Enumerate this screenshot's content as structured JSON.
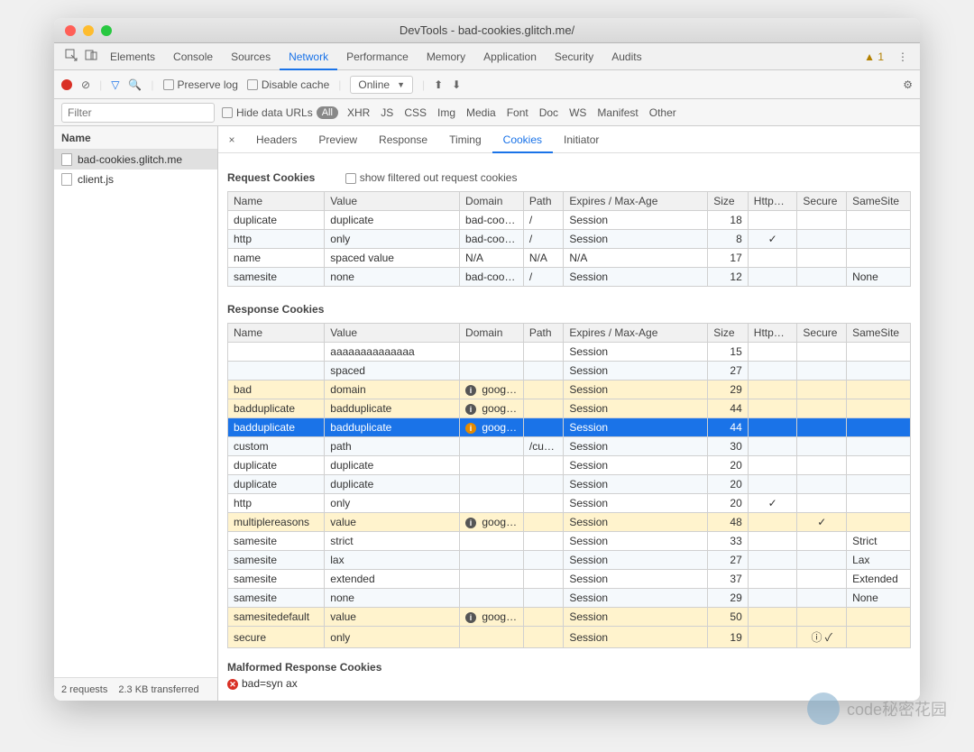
{
  "window": {
    "title": "DevTools - bad-cookies.glitch.me/"
  },
  "warnings": {
    "count": "1"
  },
  "tabs": [
    "Elements",
    "Console",
    "Sources",
    "Network",
    "Performance",
    "Memory",
    "Application",
    "Security",
    "Audits"
  ],
  "active_tab": "Network",
  "toolbar": {
    "preserve_log": "Preserve log",
    "disable_cache": "Disable cache",
    "online": "Online"
  },
  "filter": {
    "placeholder": "Filter",
    "hide_data_urls": "Hide data URLs",
    "all": "All",
    "types": [
      "XHR",
      "JS",
      "CSS",
      "Img",
      "Media",
      "Font",
      "Doc",
      "WS",
      "Manifest",
      "Other"
    ]
  },
  "sidebar": {
    "header": "Name",
    "items": [
      "bad-cookies.glitch.me",
      "client.js"
    ],
    "footer_requests": "2 requests",
    "footer_transferred": "2.3 KB transferred"
  },
  "subtabs": [
    "Headers",
    "Preview",
    "Response",
    "Timing",
    "Cookies",
    "Initiator"
  ],
  "active_subtab": "Cookies",
  "request_cookies": {
    "title": "Request Cookies",
    "show_filtered": "show filtered out request cookies",
    "cols": [
      "Name",
      "Value",
      "Domain",
      "Path",
      "Expires / Max-Age",
      "Size",
      "HttpO…",
      "Secure",
      "SameSite"
    ],
    "rows": [
      {
        "name": "duplicate",
        "value": "duplicate",
        "domain": "bad-coo…",
        "path": "/",
        "expires": "Session",
        "size": "18",
        "httpOnly": "",
        "secure": "",
        "samesite": ""
      },
      {
        "name": "http",
        "value": "only",
        "domain": "bad-coo…",
        "path": "/",
        "expires": "Session",
        "size": "8",
        "httpOnly": "✓",
        "secure": "",
        "samesite": ""
      },
      {
        "name": "name",
        "value": "spaced value",
        "domain": "N/A",
        "path": "N/A",
        "expires": "N/A",
        "size": "17",
        "httpOnly": "",
        "secure": "",
        "samesite": ""
      },
      {
        "name": "samesite",
        "value": "none",
        "domain": "bad-coo…",
        "path": "/",
        "expires": "Session",
        "size": "12",
        "httpOnly": "",
        "secure": "",
        "samesite": "None"
      }
    ]
  },
  "response_cookies": {
    "title": "Response Cookies",
    "cols": [
      "Name",
      "Value",
      "Domain",
      "Path",
      "Expires / Max-Age",
      "Size",
      "HttpO…",
      "Secure",
      "SameSite"
    ],
    "rows": [
      {
        "cls": "even",
        "name": "",
        "value": "aaaaaaaaaaaaaa",
        "domain": "",
        "path": "",
        "expires": "Session",
        "size": "15",
        "httpOnly": "",
        "secure": "",
        "samesite": ""
      },
      {
        "cls": "odd",
        "name": "",
        "value": "spaced",
        "domain": "",
        "path": "",
        "expires": "Session",
        "size": "27",
        "httpOnly": "",
        "secure": "",
        "samesite": ""
      },
      {
        "cls": "warn",
        "name": "bad",
        "value": "domain",
        "domain": "googl…",
        "domIcon": "info",
        "path": "",
        "expires": "Session",
        "size": "29",
        "httpOnly": "",
        "secure": "",
        "samesite": ""
      },
      {
        "cls": "warn",
        "name": "badduplicate",
        "value": "badduplicate",
        "domain": "googl…",
        "domIcon": "info",
        "path": "",
        "expires": "Session",
        "size": "44",
        "httpOnly": "",
        "secure": "",
        "samesite": ""
      },
      {
        "cls": "sel",
        "name": "badduplicate",
        "value": "badduplicate",
        "domain": "googl…",
        "domIcon": "warn",
        "path": "",
        "expires": "Session",
        "size": "44",
        "httpOnly": "",
        "secure": "",
        "samesite": ""
      },
      {
        "cls": "odd",
        "name": "custom",
        "value": "path",
        "domain": "",
        "path": "/cu…",
        "expires": "Session",
        "size": "30",
        "httpOnly": "",
        "secure": "",
        "samesite": ""
      },
      {
        "cls": "even",
        "name": "duplicate",
        "value": "duplicate",
        "domain": "",
        "path": "",
        "expires": "Session",
        "size": "20",
        "httpOnly": "",
        "secure": "",
        "samesite": ""
      },
      {
        "cls": "odd",
        "name": "duplicate",
        "value": "duplicate",
        "domain": "",
        "path": "",
        "expires": "Session",
        "size": "20",
        "httpOnly": "",
        "secure": "",
        "samesite": ""
      },
      {
        "cls": "even",
        "name": "http",
        "value": "only",
        "domain": "",
        "path": "",
        "expires": "Session",
        "size": "20",
        "httpOnly": "✓",
        "secure": "",
        "samesite": ""
      },
      {
        "cls": "warn",
        "name": "multiplereasons",
        "value": "value",
        "domain": "googl…",
        "domIcon": "info",
        "path": "",
        "expires": "Session",
        "size": "48",
        "httpOnly": "",
        "secure": "✓",
        "samesite": ""
      },
      {
        "cls": "even",
        "name": "samesite",
        "value": "strict",
        "domain": "",
        "path": "",
        "expires": "Session",
        "size": "33",
        "httpOnly": "",
        "secure": "",
        "samesite": "Strict"
      },
      {
        "cls": "odd",
        "name": "samesite",
        "value": "lax",
        "domain": "",
        "path": "",
        "expires": "Session",
        "size": "27",
        "httpOnly": "",
        "secure": "",
        "samesite": "Lax"
      },
      {
        "cls": "even",
        "name": "samesite",
        "value": "extended",
        "domain": "",
        "path": "",
        "expires": "Session",
        "size": "37",
        "httpOnly": "",
        "secure": "",
        "samesite": "Extended"
      },
      {
        "cls": "odd",
        "name": "samesite",
        "value": "none",
        "domain": "",
        "path": "",
        "expires": "Session",
        "size": "29",
        "httpOnly": "",
        "secure": "",
        "samesite": "None"
      },
      {
        "cls": "warn",
        "name": "samesitedefault",
        "value": "value",
        "domain": "googl…",
        "domIcon": "info",
        "path": "",
        "expires": "Session",
        "size": "50",
        "httpOnly": "",
        "secure": "",
        "samesite": ""
      },
      {
        "cls": "warn",
        "name": "secure",
        "value": "only",
        "domain": "",
        "path": "",
        "expires": "Session",
        "size": "19",
        "httpOnly": "",
        "secure": "ⓘ ✓",
        "samesite": ""
      }
    ]
  },
  "malformed": {
    "title": "Malformed Response Cookies",
    "text": "bad=syn   ax"
  },
  "watermark": "code秘密花园"
}
